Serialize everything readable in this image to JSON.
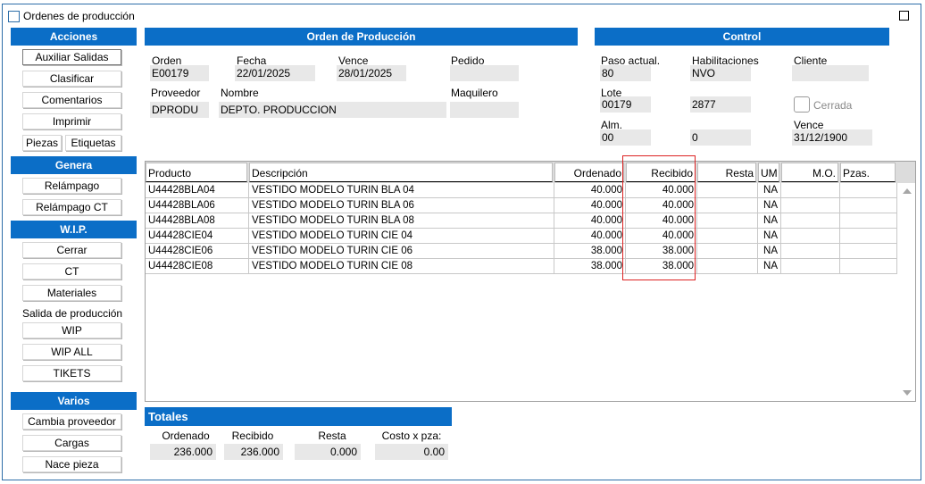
{
  "window": {
    "title": "Ordenes de producción"
  },
  "sidebar": {
    "acciones": {
      "title": "Acciones",
      "items": [
        "Auxiliar Salidas",
        "Clasificar",
        "Comentarios",
        "Imprimir",
        "Piezas",
        "Etiquetas"
      ]
    },
    "genera": {
      "title": "Genera",
      "items": [
        "Relámpago",
        "Relámpago CT"
      ]
    },
    "wip": {
      "title": "W.I.P.",
      "items": [
        "Cerrar",
        "CT",
        "Materiales",
        "Salida de producción",
        "WIP",
        "WIP ALL",
        "TIKETS"
      ]
    },
    "varios": {
      "title": "Varios",
      "items": [
        "Cambia proveedor",
        "Cargas",
        "Nace pieza"
      ]
    }
  },
  "orden": {
    "title": "Orden de Producción",
    "orden_label": "Orden",
    "orden_value": "E00179",
    "fecha_label": "Fecha",
    "fecha_value": "22/01/2025",
    "vence_label": "Vence",
    "vence_value": "28/01/2025",
    "pedido_label": "Pedido",
    "pedido_value": "",
    "proveedor_label": "Proveedor",
    "proveedor_value": "DPRODU",
    "nombre_label": "Nombre",
    "nombre_value": "DEPTO. PRODUCCION",
    "maquilero_label": "Maquilero",
    "maquilero_value": ""
  },
  "control": {
    "title": "Control",
    "paso_label": "Paso actual.",
    "paso_value": "80",
    "habil_label": "Habilitaciones",
    "habil_value": "NVO",
    "cliente_label": "Cliente",
    "cliente_value": "",
    "lote_label": "Lote",
    "lote_value": "00179",
    "lote_value2": "2877",
    "cerrada_label": "Cerrada",
    "alm_label": "Alm.",
    "alm_value": "00",
    "alm_value2": "0",
    "vence_label": "Vence",
    "vence_value": "31/12/1900"
  },
  "grid": {
    "headers": [
      "Producto",
      "Descripción",
      "Ordenado",
      "Recibido",
      "Resta",
      "UM",
      "M.O.",
      "Pzas."
    ],
    "rows": [
      [
        "U44428BLA04",
        "VESTIDO MODELO TURIN BLA 04",
        "40.000",
        "40.000",
        "",
        "NA",
        "",
        ""
      ],
      [
        "U44428BLA06",
        "VESTIDO MODELO TURIN BLA 06",
        "40.000",
        "40.000",
        "",
        "NA",
        "",
        ""
      ],
      [
        "U44428BLA08",
        "VESTIDO MODELO TURIN BLA 08",
        "40.000",
        "40.000",
        "",
        "NA",
        "",
        ""
      ],
      [
        "U44428CIE04",
        "VESTIDO MODELO TURIN CIE 04",
        "40.000",
        "40.000",
        "",
        "NA",
        "",
        ""
      ],
      [
        "U44428CIE06",
        "VESTIDO MODELO TURIN CIE 06",
        "38.000",
        "38.000",
        "",
        "NA",
        "",
        ""
      ],
      [
        "U44428CIE08",
        "VESTIDO MODELO TURIN CIE 08",
        "38.000",
        "38.000",
        "",
        "NA",
        "",
        ""
      ]
    ]
  },
  "totales": {
    "title": "Totales",
    "ordenado_label": "Ordenado",
    "ordenado_value": "236.000",
    "recibido_label": "Recibido",
    "recibido_value": "236.000",
    "resta_label": "Resta",
    "resta_value": "0.000",
    "costo_label": "Costo x pza:",
    "costo_value": "0.00"
  },
  "colors": {
    "accent": "#0b6ec7",
    "field_bg": "#e8e8e8",
    "highlight": "#dd2222"
  }
}
